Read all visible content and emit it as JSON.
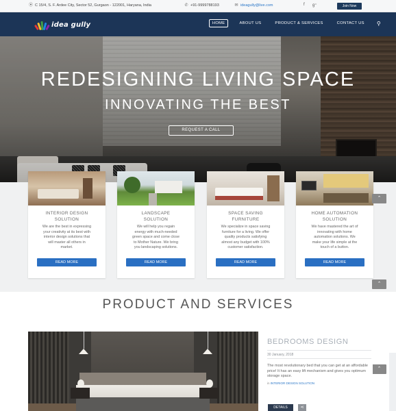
{
  "topbar": {
    "address": "C 15/4, S. F. Ardee City, Sector 52, Gurgaon - 122001, Haryana, India",
    "phone": "+91-9999788193",
    "email": "ideagully@live.com",
    "join_label": "Join Now",
    "social": [
      "facebook-icon",
      "google-plus-icon"
    ]
  },
  "header": {
    "logo_text": "idea gully",
    "nav": [
      "HOME",
      "ABOUT US",
      "PRODUCT & SERVICES",
      "CONTACT US"
    ],
    "active_nav": "HOME"
  },
  "hero": {
    "title": "REDESIGNING LIVING SPACE",
    "subtitle": "INNOVATING THE BEST",
    "cta_label": "REQUEST A CALL"
  },
  "services": [
    {
      "title_lines": [
        "INTERIOR DESIGN",
        "SOLUTION"
      ],
      "desc_lines": [
        "We are the best in expressing",
        "your creativity at its best with",
        "interior design solutions that",
        "will master all others in",
        "market."
      ],
      "button": "READ MORE"
    },
    {
      "title_lines": [
        "LANDSCAPE",
        "SOLUTION"
      ],
      "desc_lines": [
        "We will help you regain",
        "energy with much-needed",
        "green space and come close",
        "to Mother Nature. We bring",
        "you landscaping solutions."
      ],
      "button": "READ MORE"
    },
    {
      "title_lines": [
        "SPACE SAVING",
        "FURNITURE"
      ],
      "desc_lines": [
        "We specialize in space saving",
        "furniture for a living. We offer",
        "quality products satisfying",
        "almost any budget with 100%",
        "customer satisfaction."
      ],
      "button": "READ MORE"
    },
    {
      "title_lines": [
        "HOME AUTOMATION",
        "SOLUTION"
      ],
      "desc_lines": [
        "We have mastered the art of",
        "innovating with home",
        "automation solutions. We",
        "make your life simple at the",
        "touch of a button."
      ],
      "button": "READ MORE"
    }
  ],
  "products": {
    "section_title": "PRODUCT AND SERVICES",
    "post": {
      "title": "BEDROOMS DESIGN",
      "date": "30 January, 2018",
      "desc": "The most revolutionary bed that you can get at an affordable price! It has an easy lift mechanism and gives you optimum storage space.",
      "category_prefix": "in",
      "category": "INTERIOR DESIGN SOLUTION",
      "details_label": "DETAILS"
    }
  },
  "colors": {
    "header_bg": "#1c3557",
    "button_blue": "#2a6fc2",
    "link_blue": "#2a76c7"
  }
}
